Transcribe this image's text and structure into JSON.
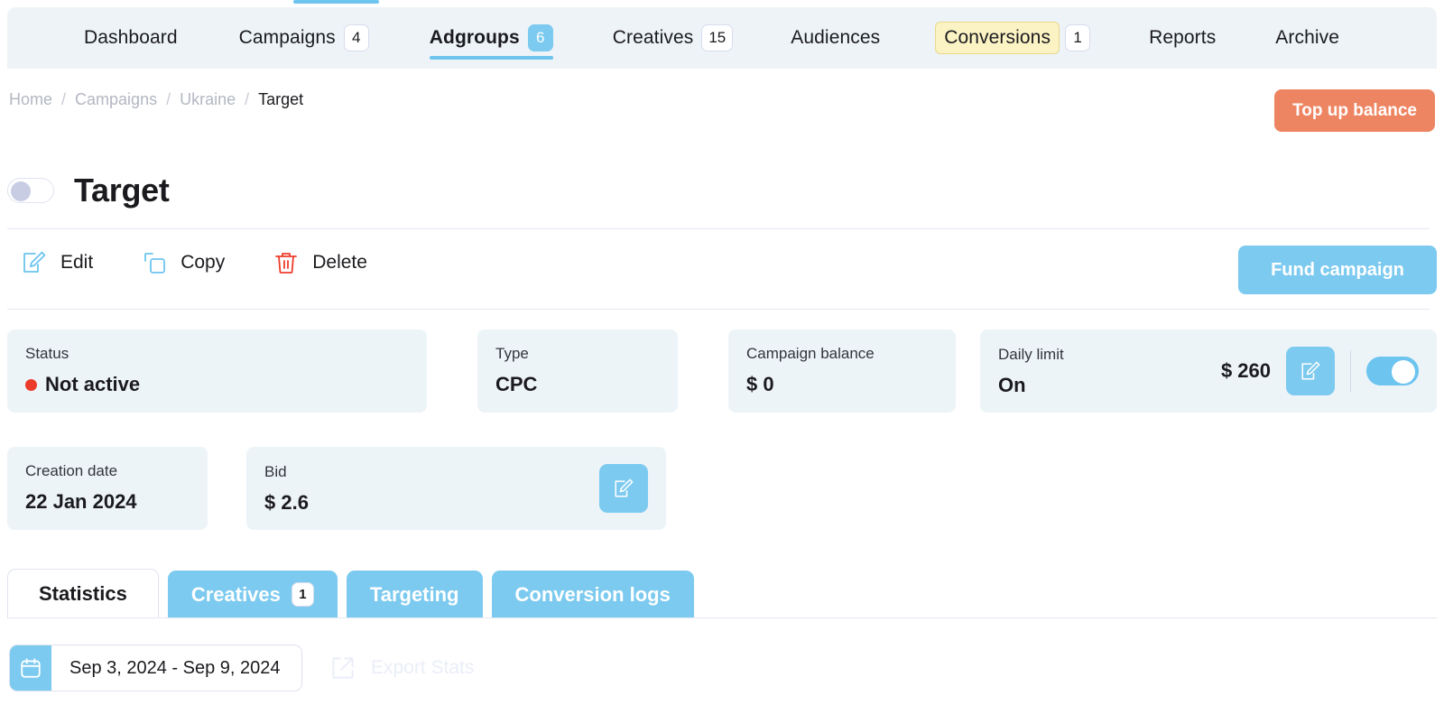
{
  "nav": {
    "items": [
      {
        "label": "Dashboard",
        "badge": null,
        "active": false,
        "highlight": false
      },
      {
        "label": "Campaigns",
        "badge": "4",
        "active": false,
        "highlight": false
      },
      {
        "label": "Adgroups",
        "badge": "6",
        "active": true,
        "highlight": false
      },
      {
        "label": "Creatives",
        "badge": "15",
        "active": false,
        "highlight": false
      },
      {
        "label": "Audiences",
        "badge": null,
        "active": false,
        "highlight": false
      },
      {
        "label": "Conversions",
        "badge": "1",
        "active": false,
        "highlight": true
      },
      {
        "label": "Reports",
        "badge": null,
        "active": false,
        "highlight": false
      },
      {
        "label": "Archive",
        "badge": null,
        "active": false,
        "highlight": false
      }
    ]
  },
  "breadcrumb": {
    "items": [
      "Home",
      "Campaigns",
      "Ukraine",
      "Target"
    ],
    "separator": "/"
  },
  "header": {
    "topup_label": "Top up balance",
    "title": "Target",
    "toggle_state": "off"
  },
  "actions": {
    "edit_label": "Edit",
    "copy_label": "Copy",
    "delete_label": "Delete",
    "fund_label": "Fund campaign"
  },
  "cards": {
    "status": {
      "label": "Status",
      "value": "Not active"
    },
    "type": {
      "label": "Type",
      "value": "CPC"
    },
    "balance": {
      "label": "Campaign balance",
      "value": "$ 0"
    },
    "daily": {
      "label": "Daily limit",
      "value": "On",
      "amount": "$ 260",
      "toggle_state": "on"
    },
    "creation": {
      "label": "Creation date",
      "value": "22 Jan 2024"
    },
    "bid": {
      "label": "Bid",
      "value": "$ 2.6"
    }
  },
  "tabs": [
    {
      "label": "Statistics",
      "badge": null,
      "active": true
    },
    {
      "label": "Creatives",
      "badge": "1",
      "active": false
    },
    {
      "label": "Targeting",
      "badge": null,
      "active": false
    },
    {
      "label": "Conversion logs",
      "badge": null,
      "active": false
    }
  ],
  "toolbar": {
    "date_range": "Sep 3, 2024  -  Sep 9, 2024",
    "export_label": "Export Stats"
  },
  "colors": {
    "accent_blue": "#7ccaef",
    "accent_orange": "#ee8562",
    "status_red": "#ec3b2a",
    "card_bg": "#edf4f8",
    "nav_bg": "#edf3f7",
    "highlight_yellow": "#fcf3c4"
  }
}
